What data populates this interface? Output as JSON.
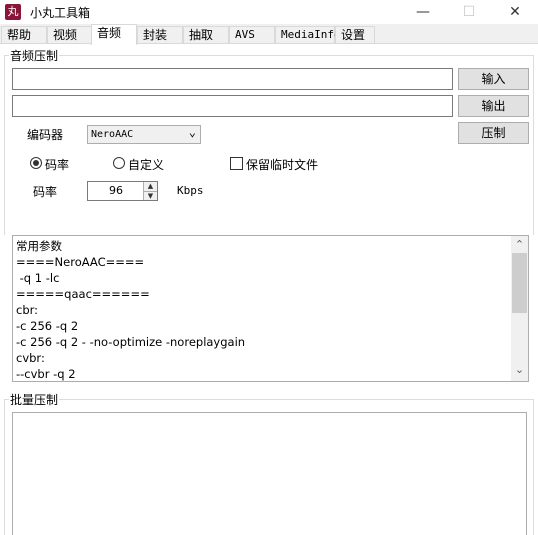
{
  "window": {
    "title": "小丸工具箱",
    "app_icon_glyph": "丸",
    "minimize_glyph": "—",
    "maximize_glyph": "☐",
    "close_glyph": "✕"
  },
  "tabs": [
    {
      "label": "帮助"
    },
    {
      "label": "视频"
    },
    {
      "label": "音频"
    },
    {
      "label": "封装"
    },
    {
      "label": "抽取"
    },
    {
      "label": "AVS"
    },
    {
      "label": "MediaInfo"
    },
    {
      "label": "设置"
    }
  ],
  "active_tab": "音频",
  "audio_group": {
    "label": "音频压制",
    "input_value": "",
    "output_value": "",
    "input_button": "输入",
    "output_button": "输出",
    "encode_button": "压制",
    "encoder_label": "编码器",
    "encoder_value": "NeroAAC",
    "mode_bitrate_label": "码率",
    "mode_custom_label": "自定义",
    "keep_temp_label": "保留临时文件",
    "bitrate_label": "码率",
    "bitrate_value": "96",
    "bitrate_unit": "Kbps",
    "selected_mode": "码率",
    "keep_temp_checked": false
  },
  "params_text": [
    "常用参数",
    "====NeroAAC====",
    " -q 1 -lc",
    "=====qaac======",
    "cbr:",
    "-c 256 -q 2",
    "-c 256 -q 2 - -no-optimize -noreplaygain",
    "cvbr:",
    "--cvbr -q 2"
  ],
  "batch_group": {
    "label": "批量压制"
  },
  "icons": {
    "combo_arrow": "⌄",
    "spin_up": "▲",
    "spin_down": "▼",
    "scroll_up": "⌃",
    "scroll_down": "⌄"
  }
}
